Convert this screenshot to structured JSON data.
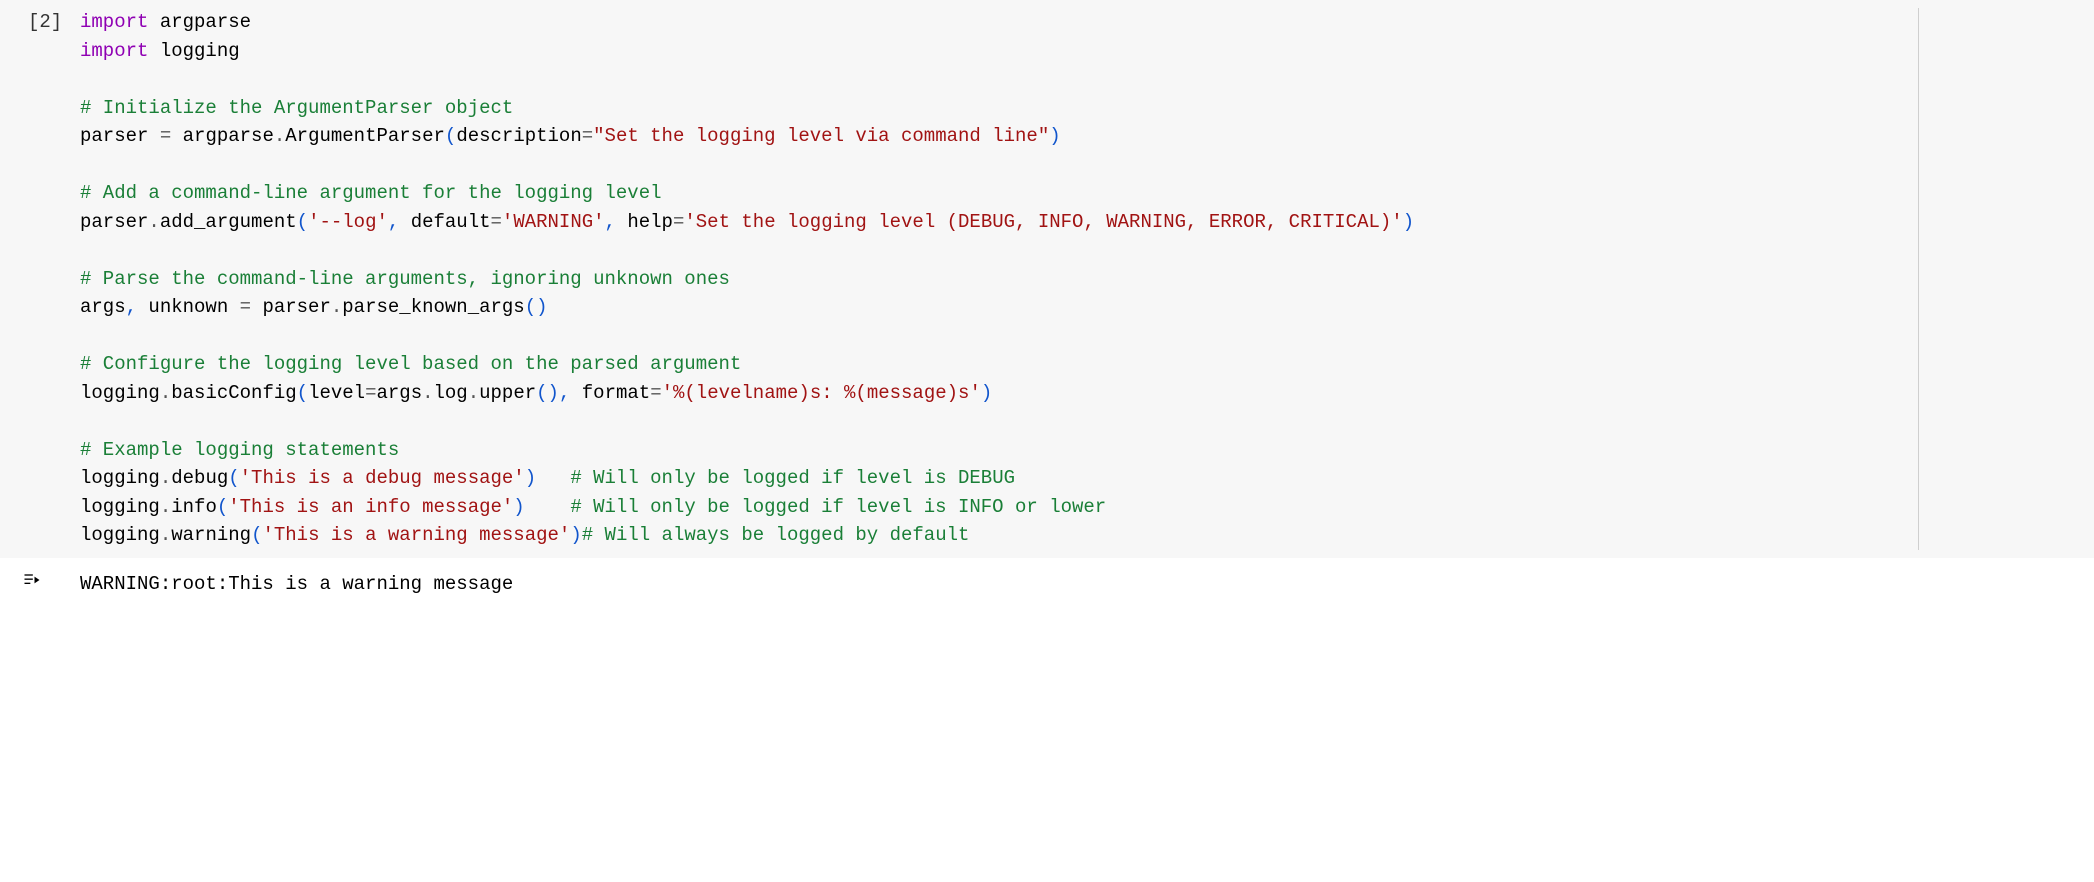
{
  "cell": {
    "execution_label": "[2]",
    "code": {
      "l1": {
        "kw1": "import",
        "nm1": " argparse"
      },
      "l2": {
        "kw1": "import",
        "nm1": " logging"
      },
      "l3": "",
      "l4": {
        "cm": "# Initialize the ArgumentParser object"
      },
      "l5": {
        "t1": "parser ",
        "op1": "=",
        "t2": " argparse",
        "op2": ".",
        "t3": "ArgumentParser",
        "p1": "(",
        "t4": "description",
        "op3": "=",
        "s1": "\"Set the logging level via command line\"",
        "p2": ")"
      },
      "l6": "",
      "l7": {
        "cm": "# Add a command-line argument for the logging level"
      },
      "l8": {
        "t1": "parser",
        "op1": ".",
        "t2": "add_argument",
        "p1": "(",
        "s1": "'--log'",
        "c1": ",",
        "t3": " default",
        "op2": "=",
        "s2": "'WARNING'",
        "c2": ",",
        "t4": " help",
        "op3": "=",
        "s3": "'Set the logging level (DEBUG, INFO, WARNING, ERROR, CRITICAL)'",
        "p2": ")"
      },
      "l9": "",
      "l10": {
        "cm": "# Parse the command-line arguments, ignoring unknown ones"
      },
      "l11": {
        "t1": "args",
        "c1": ",",
        "t2": " unknown ",
        "op1": "=",
        "t3": " parser",
        "op2": ".",
        "t4": "parse_known_args",
        "p1": "(",
        "p2": ")"
      },
      "l12": "",
      "l13": {
        "cm": "# Configure the logging level based on the parsed argument"
      },
      "l14": {
        "t1": "logging",
        "op1": ".",
        "t2": "basicConfig",
        "p1": "(",
        "t3": "level",
        "op2": "=",
        "t4": "args",
        "op3": ".",
        "t5": "log",
        "op4": ".",
        "t6": "upper",
        "p2": "(",
        "p3": ")",
        "c1": ",",
        "t7": " format",
        "op5": "=",
        "s1": "'%(levelname)s: %(message)s'",
        "p4": ")"
      },
      "l15": "",
      "l16": {
        "cm": "# Example logging statements"
      },
      "l17": {
        "t1": "logging",
        "op1": ".",
        "t2": "debug",
        "p1": "(",
        "s1": "'This is a debug message'",
        "p2": ")",
        "pad": "   ",
        "cm": "# Will only be logged if level is DEBUG"
      },
      "l18": {
        "t1": "logging",
        "op1": ".",
        "t2": "info",
        "p1": "(",
        "s1": "'This is an info message'",
        "p2": ")",
        "pad": "    ",
        "cm": "# Will only be logged if level is INFO or lower"
      },
      "l19": {
        "t1": "logging",
        "op1": ".",
        "t2": "warning",
        "p1": "(",
        "s1": "'This is a warning message'",
        "p2": ")",
        "cm": "# Will always be logged by default"
      }
    }
  },
  "output": {
    "text": "WARNING:root:This is a warning message"
  }
}
